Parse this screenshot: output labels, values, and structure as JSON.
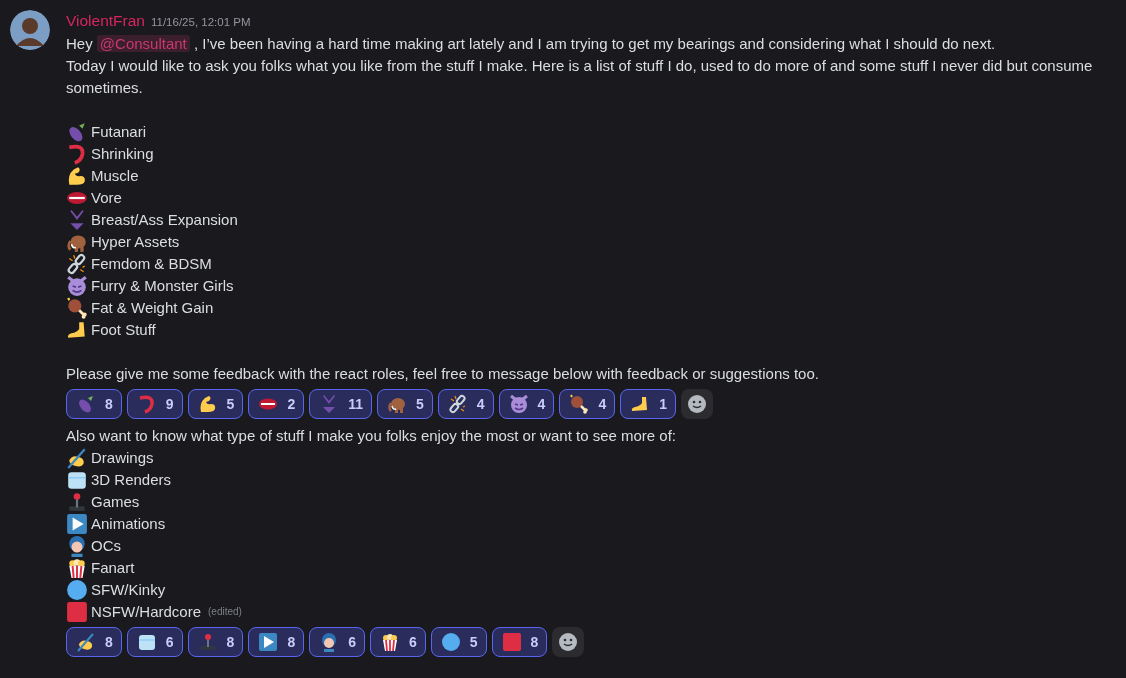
{
  "message": {
    "author": "ViolentFran",
    "timestamp": "11/16/25, 12:01 PM",
    "intro": {
      "before": "Hey",
      "mention": "@Consultant",
      "after": ", I’ve been having a hard time making art lately and I am trying to get my bearings and considering what I should do next."
    },
    "intro_line_2": "Today I would like to ask you folks what you like from the stuff I make. Here is a list of stuff I do, used to do more of and some stuff I never did but consume sometimes.",
    "poll_1": {
      "items": [
        {
          "label": "Futanari"
        },
        {
          "label": "Shrinking"
        },
        {
          "label": "Muscle"
        },
        {
          "label": "Vore"
        },
        {
          "label": "Breast/Ass Expansion"
        },
        {
          "label": "Hyper Assets"
        },
        {
          "label": "Femdom & BDSM"
        },
        {
          "label": "Furry & Monster Girls"
        },
        {
          "label": "Fat & Weight Gain"
        },
        {
          "label": "Foot Stuff"
        }
      ],
      "note": "Please give me some feedback with the react roles, feel free to message below with feedback or suggestions too.",
      "reactions": [
        {
          "count": "8",
          "selected": true
        },
        {
          "count": "9",
          "selected": true
        },
        {
          "count": "5",
          "selected": true
        },
        {
          "count": "2",
          "selected": true
        },
        {
          "count": "11",
          "selected": true
        },
        {
          "count": "5",
          "selected": true
        },
        {
          "count": "4",
          "selected": true
        },
        {
          "count": "4",
          "selected": true
        },
        {
          "count": "4",
          "selected": true
        },
        {
          "count": "1",
          "selected": true
        }
      ]
    },
    "poll_2": {
      "heading": "Also want to know what type of stuff I make you folks enjoy the most or want to see more of:",
      "items": [
        {
          "label": "Drawings"
        },
        {
          "label": "3D Renders"
        },
        {
          "label": "Games"
        },
        {
          "label": "Animations"
        },
        {
          "label": "OCs"
        },
        {
          "label": "Fanart"
        },
        {
          "label": "SFW/Kinky"
        },
        {
          "label": "NSFW/Hardcore"
        }
      ],
      "edited": "(edited)",
      "reactions": [
        {
          "count": "8",
          "selected": true
        },
        {
          "count": "6",
          "selected": true
        },
        {
          "count": "8",
          "selected": true
        },
        {
          "count": "8",
          "selected": true
        },
        {
          "count": "6",
          "selected": true
        },
        {
          "count": "6",
          "selected": true
        },
        {
          "count": "5",
          "selected": true
        },
        {
          "count": "8",
          "selected": true
        }
      ]
    }
  }
}
